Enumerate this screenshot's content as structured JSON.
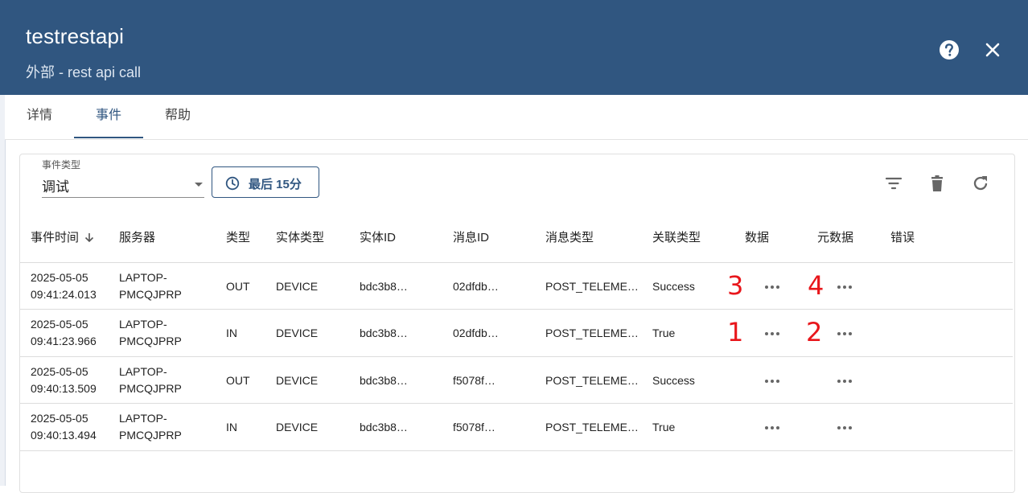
{
  "header": {
    "title": "testrestapi",
    "subtitle": "外部 - rest api call"
  },
  "tabs": [
    {
      "label": "详情",
      "active": false
    },
    {
      "label": "事件",
      "active": true
    },
    {
      "label": "帮助",
      "active": false
    }
  ],
  "filter": {
    "event_type_label": "事件类型",
    "event_type_value": "调试",
    "time_button_label": "最后 15分"
  },
  "toolbar": {
    "icons": [
      "filter-icon",
      "delete-icon",
      "refresh-icon"
    ]
  },
  "table": {
    "columns": [
      "事件时间",
      "服务器",
      "类型",
      "实体类型",
      "实体ID",
      "消息ID",
      "消息类型",
      "关联类型",
      "数据",
      "元数据",
      "错误"
    ],
    "rows": [
      {
        "time_date": "2025-05-05",
        "time_clock": "09:41:24.013",
        "server_a": "LAPTOP-",
        "server_b": "PMCQJPRP",
        "type": "OUT",
        "entity_type": "DEVICE",
        "entity_id": "bdc3b8…",
        "message_id": "02dfdb…",
        "message_type": "POST_TELEMET…",
        "relation_type": "Success"
      },
      {
        "time_date": "2025-05-05",
        "time_clock": "09:41:23.966",
        "server_a": "LAPTOP-",
        "server_b": "PMCQJPRP",
        "type": "IN",
        "entity_type": "DEVICE",
        "entity_id": "bdc3b8…",
        "message_id": "02dfdb…",
        "message_type": "POST_TELEMET…",
        "relation_type": "True"
      },
      {
        "time_date": "2025-05-05",
        "time_clock": "09:40:13.509",
        "server_a": "LAPTOP-",
        "server_b": "PMCQJPRP",
        "type": "OUT",
        "entity_type": "DEVICE",
        "entity_id": "bdc3b8…",
        "message_id": "f5078f…",
        "message_type": "POST_TELEMET…",
        "relation_type": "Success"
      },
      {
        "time_date": "2025-05-05",
        "time_clock": "09:40:13.494",
        "server_a": "LAPTOP-",
        "server_b": "PMCQJPRP",
        "type": "IN",
        "entity_type": "DEVICE",
        "entity_id": "bdc3b8…",
        "message_id": "f5078f…",
        "message_type": "POST_TELEMET…",
        "relation_type": "True"
      }
    ]
  },
  "annotations": [
    "3",
    "4",
    "1",
    "2"
  ],
  "colors": {
    "header_bg": "#305680",
    "accent": "#305680",
    "annotation": "#e8161b"
  }
}
